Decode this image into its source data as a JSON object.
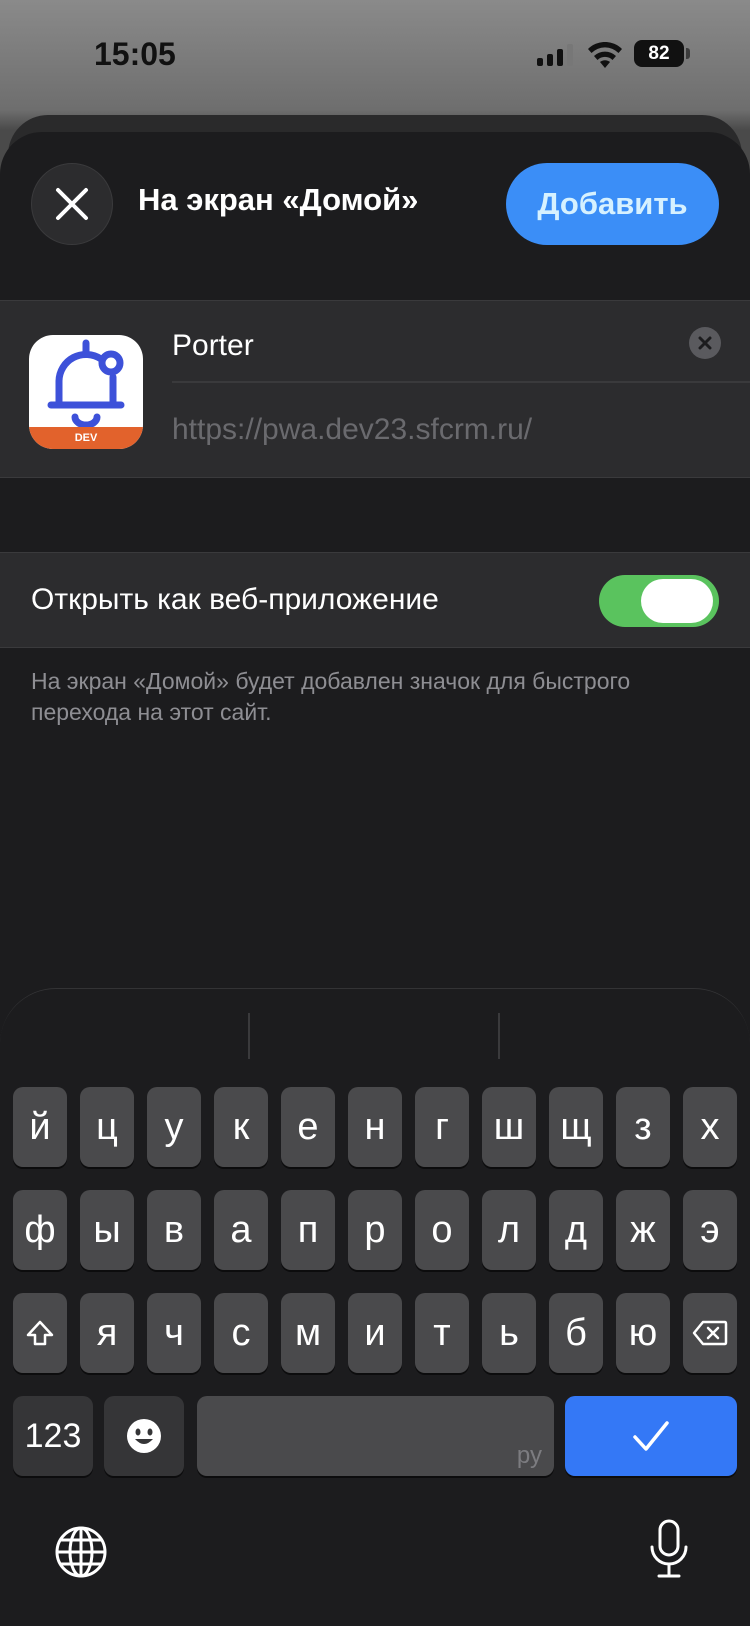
{
  "status_bar": {
    "time": "15:05",
    "battery": "82"
  },
  "header": {
    "title": "На экран «Домой»",
    "add_label": "Добавить"
  },
  "bookmark": {
    "name": "Porter",
    "url": "https://pwa.dev23.sfcrm.ru/",
    "icon_badge": "DEV"
  },
  "web_app_toggle": {
    "label": "Открыть как веб-приложение",
    "enabled": true
  },
  "footnote": "На экран «Домой» будет добавлен значок для быстрого перехода на этот сайт.",
  "keyboard": {
    "row1": [
      "й",
      "ц",
      "у",
      "к",
      "е",
      "н",
      "г",
      "ш",
      "щ",
      "з",
      "х"
    ],
    "row2": [
      "ф",
      "ы",
      "в",
      "а",
      "п",
      "р",
      "о",
      "л",
      "д",
      "ж",
      "э"
    ],
    "row3": [
      "я",
      "ч",
      "с",
      "м",
      "и",
      "т",
      "ь",
      "б",
      "ю"
    ],
    "numbers_label": "123",
    "space_lang": "ру",
    "icons": {
      "shift": "shift-icon",
      "delete": "delete-icon",
      "emoji": "emoji-icon",
      "done": "checkmark-icon",
      "globe": "globe-icon",
      "mic": "microphone-icon"
    }
  },
  "colors": {
    "accent": "#3b8ef7",
    "toggle_on": "#5ac35e",
    "icon_orange": "#e2622c",
    "icon_blue": "#3d51d9"
  }
}
